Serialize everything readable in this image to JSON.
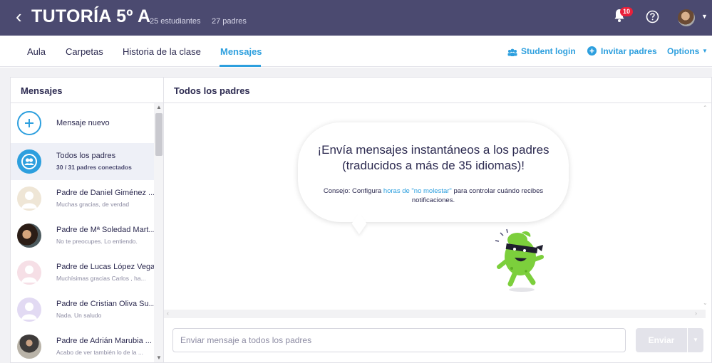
{
  "header": {
    "class_title": "TUTORÍA 5º A",
    "students": "25 estudiantes",
    "parents": "27 padres",
    "notifications": "10"
  },
  "nav": {
    "tabs": [
      "Aula",
      "Carpetas",
      "Historia de la clase",
      "Mensajes"
    ],
    "active_tab": "Mensajes",
    "student_login": "Student login",
    "invite_parents": "Invitar padres",
    "options": "Options"
  },
  "sidebar": {
    "title": "Mensajes",
    "items": [
      {
        "name": "Mensaje nuevo",
        "subtitle": ""
      },
      {
        "name": "Todos los padres",
        "subtitle": "30 / 31 padres conectados"
      },
      {
        "name": "Padre de Daniel Giménez ...",
        "subtitle": "Muchas gracias, de verdad"
      },
      {
        "name": "Padre de Mª Soledad Mart...",
        "subtitle": "No te preocupes. Lo entiendo."
      },
      {
        "name": "Padre de Lucas López Vega",
        "subtitle": "Muchísimas gracias Carlos , ha..."
      },
      {
        "name": "Padre de Cristian Oliva Su...",
        "subtitle": "Nada. Un saludo"
      },
      {
        "name": "Padre de Adrián Marubia ...",
        "subtitle": "Acabo de ver también lo de la ..."
      }
    ]
  },
  "conversation": {
    "title": "Todos los padres",
    "headline": "¡Envía mensajes instantáneos a los padres (traducidos a más de 35 idiomas)!",
    "tip_prefix": "Consejo: Configura ",
    "tip_link": "horas de \"no molestar\"",
    "tip_suffix": " para controlar cuándo recibes notificaciones.",
    "composer_placeholder": "Enviar mensaje a todos los padres",
    "send_label": "Enviar"
  },
  "colors": {
    "header_bg": "#4b4a70",
    "accent": "#2d9fde",
    "badge": "#e9203a"
  }
}
